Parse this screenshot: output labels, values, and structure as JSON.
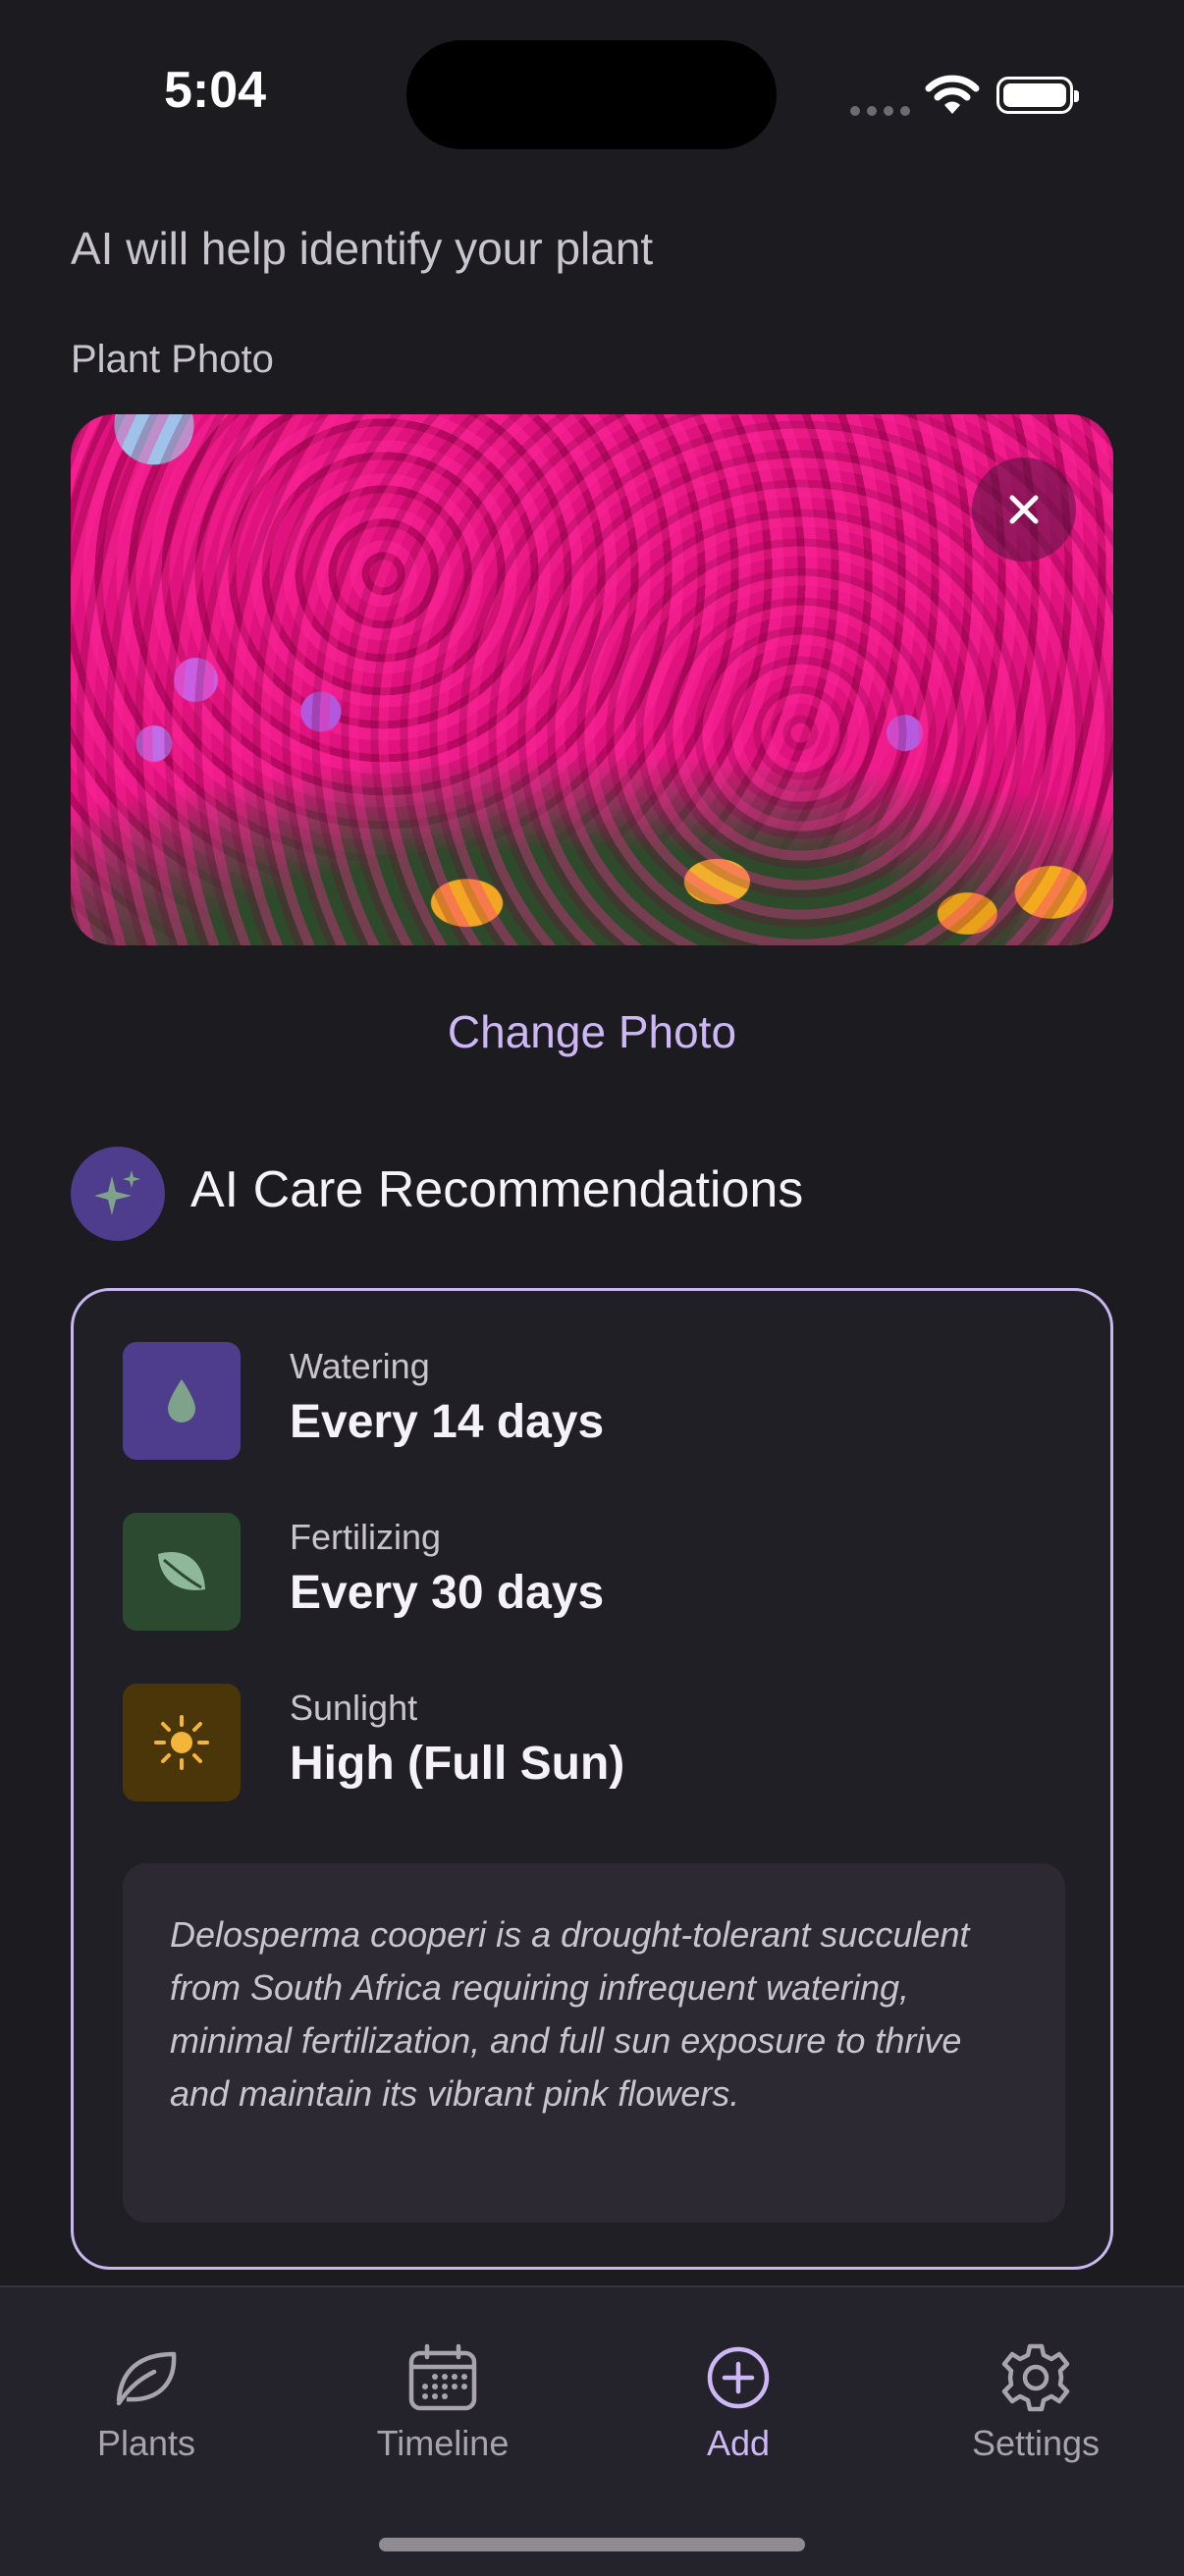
{
  "status_bar": {
    "time": "5:04"
  },
  "header": {
    "subtitle": "AI will help identify your plant"
  },
  "photo_section": {
    "label": "Plant Photo",
    "change_photo": "Change Photo"
  },
  "ai_section": {
    "title": "AI Care Recommendations",
    "recommendations": [
      {
        "label": "Watering",
        "value": "Every 14 days",
        "icon": "water-drop-icon",
        "color": "#4e3c8c"
      },
      {
        "label": "Fertilizing",
        "value": "Every 30 days",
        "icon": "leaf-icon",
        "color": "#2b4a30"
      },
      {
        "label": "Sunlight",
        "value": "High (Full Sun)",
        "icon": "sun-icon",
        "color": "#4a3608"
      }
    ],
    "description": "Delosperma cooperi is a drought-tolerant succulent from South Africa requiring infrequent watering, minimal fertilization, and full sun exposure to thrive and maintain its vibrant pink flowers."
  },
  "tab_bar": {
    "tabs": [
      {
        "label": "Plants",
        "icon": "leaf-outline-icon",
        "active": false
      },
      {
        "label": "Timeline",
        "icon": "calendar-icon",
        "active": false
      },
      {
        "label": "Add",
        "icon": "plus-circle-icon",
        "active": true
      },
      {
        "label": "Settings",
        "icon": "gear-icon",
        "active": false
      }
    ]
  },
  "colors": {
    "accent": "#cdb8f5",
    "background": "#1c1b20",
    "card_border": "#c9b7ef"
  }
}
